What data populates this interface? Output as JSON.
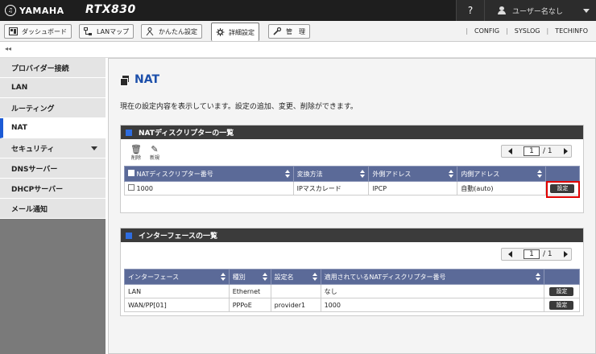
{
  "header": {
    "brand": "YAMAHA",
    "model": "RTX830",
    "help": "?",
    "user": "ユーザー名なし"
  },
  "nav": {
    "tabs": [
      {
        "label": "ダッシュボード",
        "icon": "dashboard-icon"
      },
      {
        "label": "LANマップ",
        "icon": "lan-map-icon"
      },
      {
        "label": "かんたん設定",
        "icon": "wizard-icon"
      },
      {
        "label": "詳細設定",
        "icon": "gear-icon"
      },
      {
        "label": "管　理",
        "icon": "wrench-icon"
      }
    ],
    "links": [
      "CONFIG",
      "SYSLOG",
      "TECHINFO"
    ],
    "collapse": "◂◂"
  },
  "sidebar": {
    "items": [
      {
        "label": "プロバイダー接続"
      },
      {
        "label": "LAN"
      },
      {
        "label": "ルーティング"
      },
      {
        "label": "NAT"
      },
      {
        "label": "セキュリティ"
      },
      {
        "label": "DNSサーバー"
      },
      {
        "label": "DHCPサーバー"
      },
      {
        "label": "メール通知"
      }
    ]
  },
  "main": {
    "title": "NAT",
    "description": "現在の設定内容を表示しています。設定の追加、変更、削除ができます。",
    "nat_panel": {
      "title": "NATディスクリプターの一覧",
      "delete_label": "削除",
      "new_label": "新規",
      "pager": {
        "current": "1",
        "total": "/ 1"
      },
      "columns": [
        "NATディスクリプター番号",
        "変換方法",
        "外側アドレス",
        "内側アドレス"
      ],
      "rows": [
        {
          "number": "1000",
          "method": "IPマスカレード",
          "outer": "IPCP",
          "inner": "自動(auto)",
          "action": "設定"
        }
      ]
    },
    "if_panel": {
      "title": "インターフェースの一覧",
      "pager": {
        "current": "1",
        "total": "/ 1"
      },
      "columns": [
        "インターフェース",
        "種別",
        "設定名",
        "適用されているNATディスクリプター番号"
      ],
      "rows": [
        {
          "interface": "LAN",
          "type": "Ethernet",
          "name": "",
          "nat": "なし",
          "action": "設定"
        },
        {
          "interface": "WAN/PP[01]",
          "type": "PPPoE",
          "name": "provider1",
          "nat": "1000",
          "action": "設定"
        }
      ]
    }
  }
}
